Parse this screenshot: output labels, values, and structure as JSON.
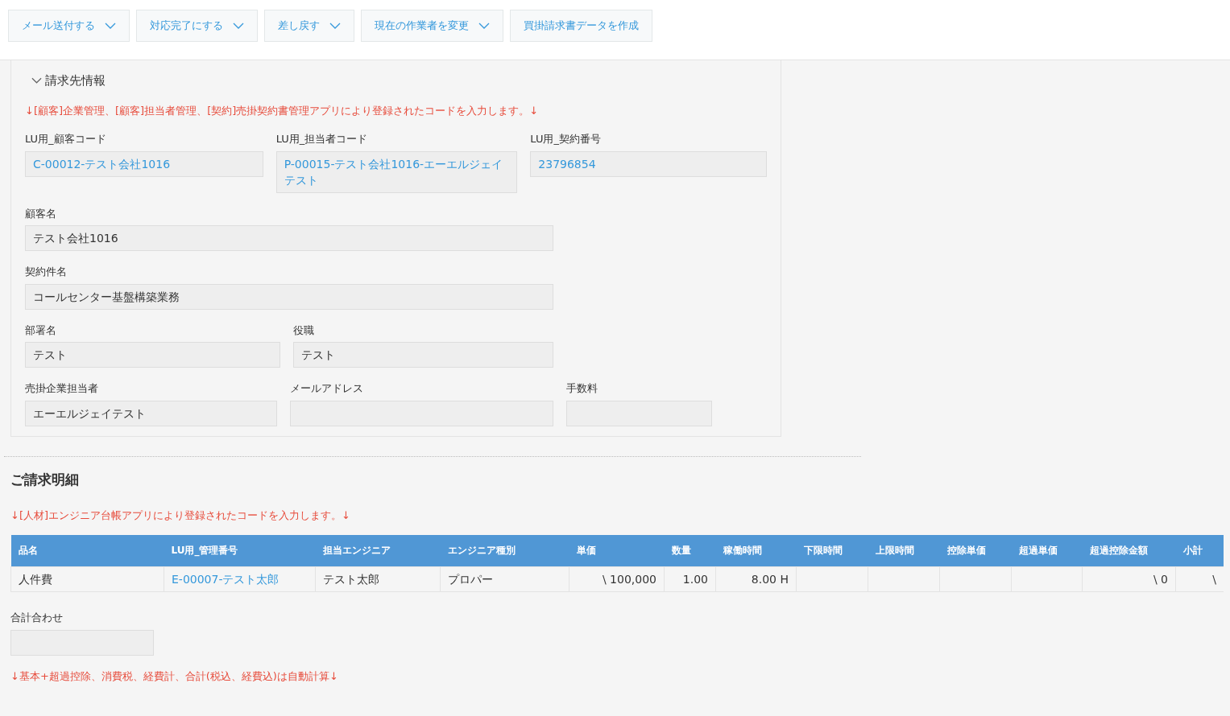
{
  "toolbar": [
    {
      "label": "メール送付する",
      "has_dropdown": true
    },
    {
      "label": "対応完了にする",
      "has_dropdown": true
    },
    {
      "label": "差し戻す",
      "has_dropdown": true
    },
    {
      "label": "現在の作業者を変更",
      "has_dropdown": true
    },
    {
      "label": "買掛請求書データを作成",
      "has_dropdown": false
    }
  ],
  "billing_section": {
    "title": "請求先情報",
    "expanded": true,
    "notice": "↓[顧客]企業管理、[顧客]担当者管理、[契約]売掛契約書管理アプリにより登録されたコードを入力します。↓",
    "field_rows": [
      [
        {
          "label": "LU用_顧客コード",
          "value": "C-00012-テスト会社1016",
          "kind": "lookup"
        },
        {
          "label": "LU用_担当者コード",
          "value": "P-00015-テスト会社1016-エーエルジェイテスト",
          "kind": "lookup"
        },
        {
          "label": "LU用_契約番号",
          "value": "23796854",
          "kind": "lookup"
        }
      ],
      [
        {
          "label": "顧客名",
          "value": "テスト会社1016",
          "kind": "text"
        }
      ],
      [
        {
          "label": "契約件名",
          "value": "コールセンター基盤構築業務",
          "kind": "text"
        }
      ],
      [
        {
          "label": "部署名",
          "value": "テスト",
          "kind": "text"
        },
        {
          "label": "役職",
          "value": "テスト",
          "kind": "text"
        }
      ],
      [
        {
          "label": "売掛企業担当者",
          "value": "エーエルジェイテスト",
          "kind": "text"
        },
        {
          "label": "メールアドレス",
          "kind": "text"
        },
        {
          "label": "手数料",
          "kind": "text"
        }
      ]
    ]
  },
  "details_section": {
    "title": "ご請求明細",
    "notice": "↓[人材]エンジニア台帳アプリにより登録されたコードを入力します。↓",
    "table": {
      "columns": [
        "品名",
        "LU用_管理番号",
        "担当エンジニア",
        "エンジニア種別",
        "単価",
        "数量",
        "稼働時間",
        "下限時間",
        "上限時間",
        "控除単価",
        "超過単価",
        "超過控除金額",
        "小計"
      ],
      "rows": [
        [
          {
            "text": "人件費",
            "kind": "text"
          },
          {
            "text": "E-00007-テスト太郎",
            "kind": "link"
          },
          {
            "text": "テスト太郎",
            "kind": "text"
          },
          {
            "text": "プロパー",
            "kind": "text"
          },
          {
            "text": "\\ 100,000",
            "kind": "number"
          },
          {
            "text": "1.00",
            "kind": "number"
          },
          {
            "text": "8.00 H",
            "kind": "number"
          },
          {
            "text": "",
            "kind": "number"
          },
          {
            "text": "",
            "kind": "number"
          },
          {
            "text": "",
            "kind": "number"
          },
          {
            "text": "",
            "kind": "number"
          },
          {
            "text": "\\ 0",
            "kind": "number"
          },
          {
            "text": "\\",
            "kind": "number"
          }
        ]
      ]
    },
    "total_field": {
      "label": "合計合わせ"
    },
    "footer_notice": "↓基本+超過控除、消費税、経費計、合計(税込、経費込)は自動計算↓"
  }
}
